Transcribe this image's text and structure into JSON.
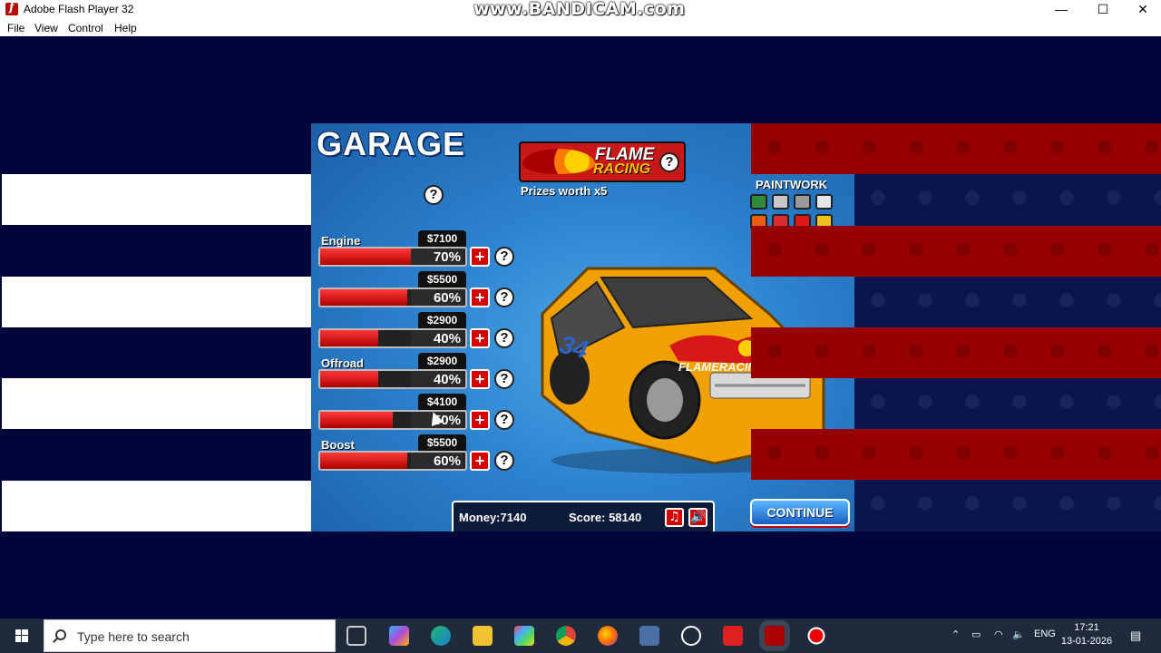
{
  "window": {
    "title": "Adobe Flash Player 32",
    "watermark": "www.BANDICAM.com",
    "controls": [
      "—",
      "☐",
      "✕"
    ]
  },
  "menu": [
    "File",
    "View",
    "Control",
    "Help"
  ],
  "game": {
    "title": "GARAGE",
    "sponsor": {
      "line1": "FLAME",
      "line2": "RACING"
    },
    "prizes": "Prizes worth x5",
    "upgrades": [
      {
        "label": "Engine",
        "price": "$7100",
        "percent": "70%",
        "level": 0.7
      },
      {
        "label": "",
        "price": "$5500",
        "percent": "60%",
        "level": 0.6
      },
      {
        "label": "",
        "price": "$2900",
        "percent": "40%",
        "level": 0.4
      },
      {
        "label": "Offroad",
        "price": "$2900",
        "percent": "40%",
        "level": 0.4
      },
      {
        "label": "",
        "price": "$4100",
        "percent": "50%",
        "level": 0.5
      },
      {
        "label": "Boost",
        "price": "$5500",
        "percent": "60%",
        "level": 0.6
      }
    ],
    "plus_symbol": "+",
    "help_symbol": "?",
    "paintwork": {
      "label": "PAINTWORK",
      "colors": [
        "#2f8a3c",
        "#c8c8c8",
        "#9a9a9a",
        "#e6e6e6",
        "#e85c10",
        "#d83030",
        "#e01818",
        "#f0c020"
      ]
    },
    "car": {
      "number": "34",
      "brand": "FLAMERACING",
      "color": "#f0a000"
    },
    "money": "Money:7140",
    "score": "Score: 58140",
    "music_icon": "♫",
    "sound_icon": "🔊",
    "continue": "CONTINUE"
  },
  "taskbar": {
    "search_placeholder": "Type here to search",
    "language": "ENG",
    "time": "17:21",
    "date": "13-01-2026"
  }
}
